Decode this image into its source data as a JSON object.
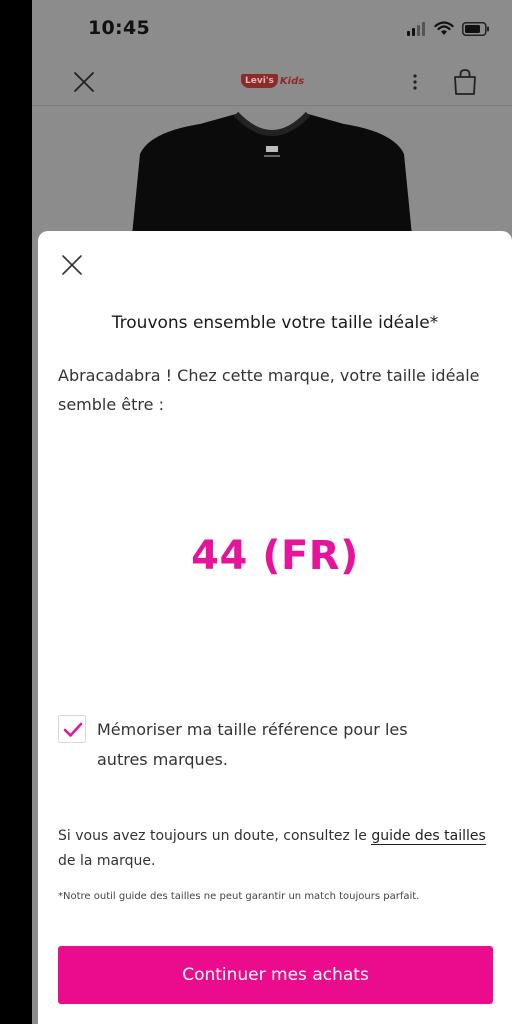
{
  "status_bar": {
    "time": "10:45"
  },
  "header": {
    "brand_badge": "Levi's",
    "brand_suffix": "Kids"
  },
  "sheet": {
    "title": "Trouvons ensemble votre taille idéale*",
    "intro": "Abracadabra ! Chez cette marque, votre taille idéale semble être :",
    "size": "44 (FR)",
    "memorize": {
      "checked": true,
      "label": "Mémoriser ma taille référence pour les autres marques."
    },
    "help": {
      "prefix": "Si vous avez toujours un doute, consultez le ",
      "link": "guide des tailles",
      "suffix": " de la marque."
    },
    "disclaimer": "*Notre outil guide des tailles ne peut garantir un match toujours parfait.",
    "cta": "Continuer mes achats"
  },
  "colors": {
    "accent": "#ea0c8c",
    "size_text": "#e6149b",
    "brand": "#8e2a2a"
  },
  "icons": [
    "close-icon",
    "more-vertical-icon",
    "shopping-bag-icon",
    "signal-icon",
    "wifi-icon",
    "battery-icon",
    "check-icon"
  ]
}
